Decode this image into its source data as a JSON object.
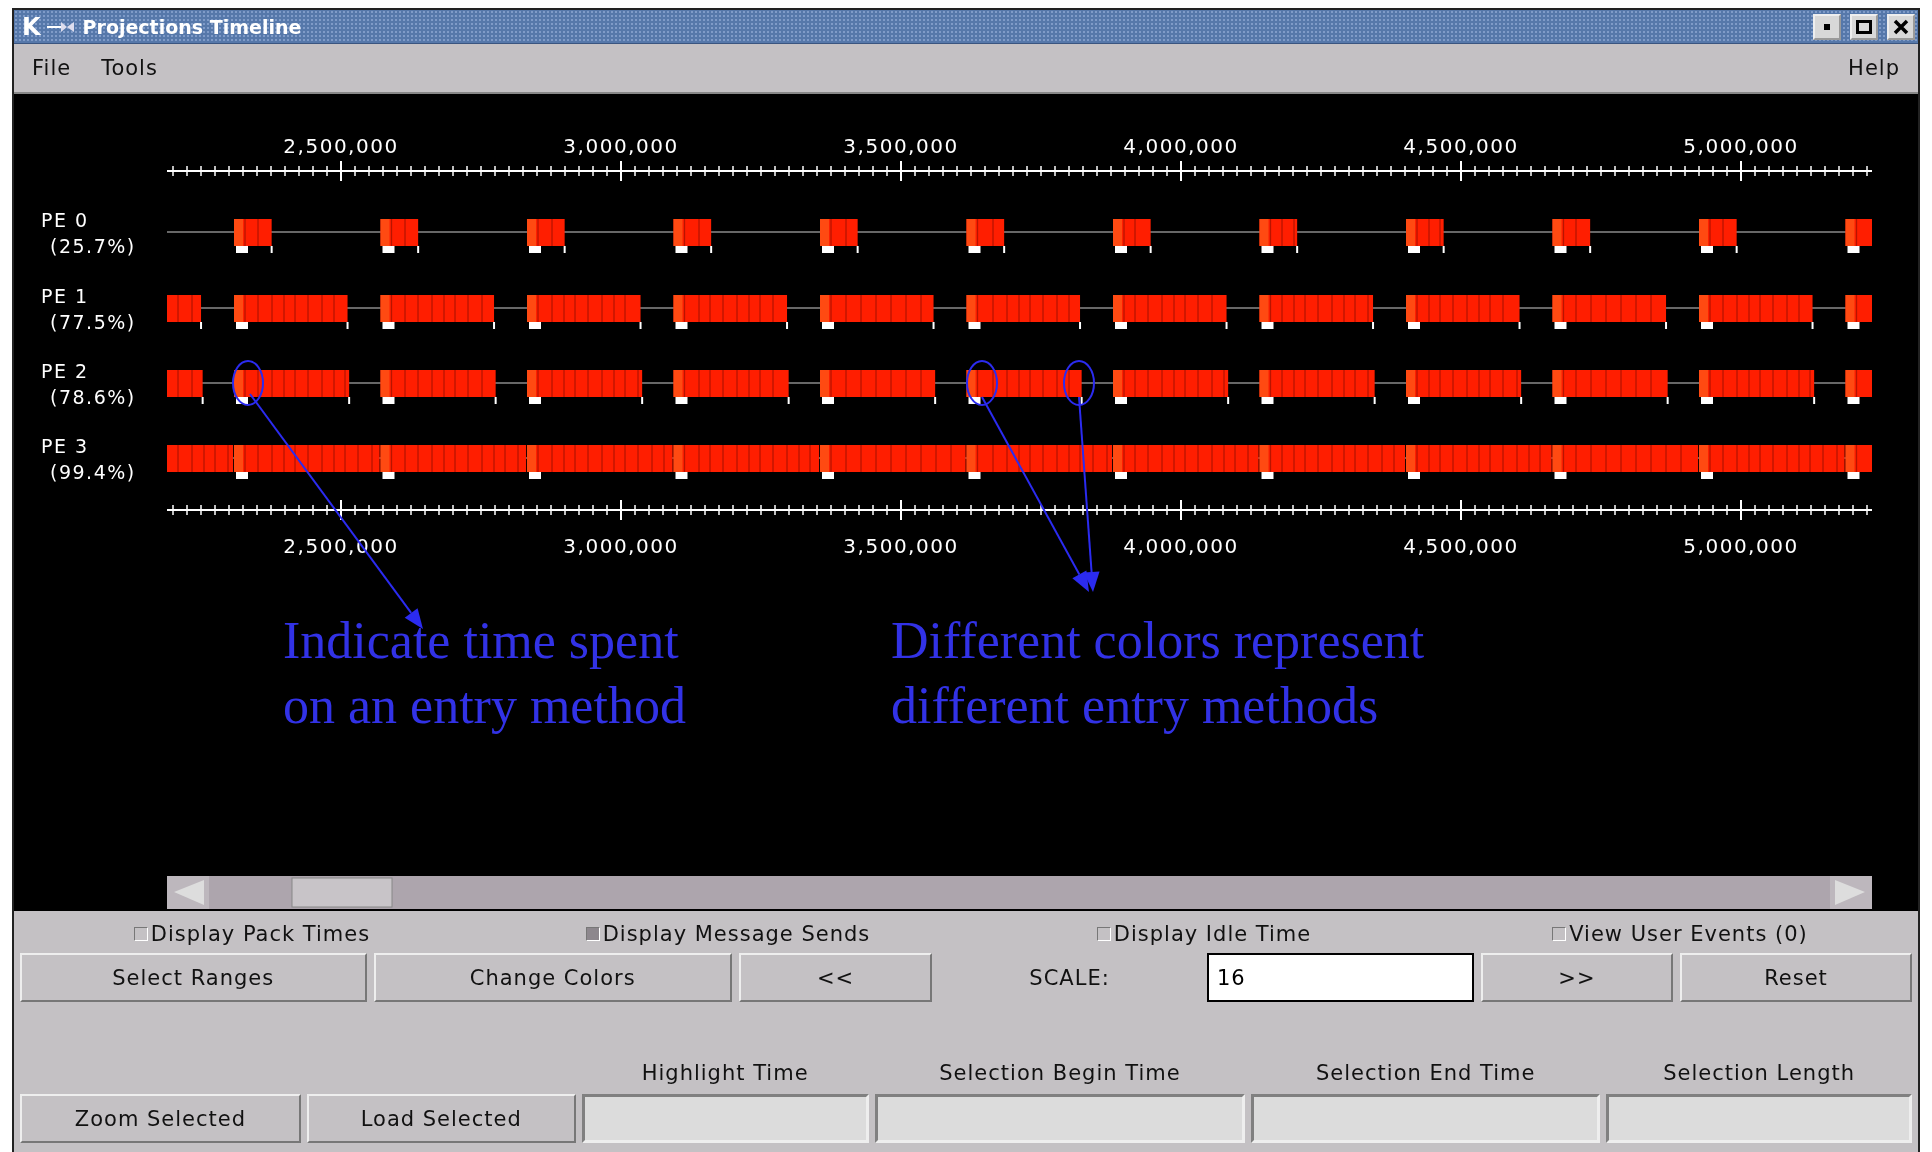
{
  "window": {
    "logo": "K",
    "title": "Projections Timeline"
  },
  "menu": [
    {
      "label": "File"
    },
    {
      "label": "Tools"
    },
    {
      "label": "Help"
    }
  ],
  "top_axis_labels": [
    "2,500,000",
    "3,000,000",
    "3,500,000",
    "4,000,000",
    "4,500,000",
    "5,000,000"
  ],
  "bottom_axis_labels": [
    "2,500,000",
    "3,000,000",
    "3,500,000",
    "4,000,000",
    "4,500,000",
    "5,000,000"
  ],
  "processors": [
    {
      "name": "PE 0",
      "utilization": "(25.7%)"
    },
    {
      "name": "PE 1",
      "utilization": "(77.5%)"
    },
    {
      "name": "PE 2",
      "utilization": "(78.6%)"
    },
    {
      "name": "PE 3",
      "utilization": "(99.4%)"
    }
  ],
  "annotations": [
    {
      "text": "Indicate time spent\non an entry method"
    },
    {
      "text": "Different colors represent\ndifferent entry methods"
    }
  ],
  "checkboxes": [
    {
      "label": "Display Pack Times",
      "checked": false,
      "disabled": false
    },
    {
      "label": "Display Message Sends",
      "checked": false,
      "disabled": true
    },
    {
      "label": "Display Idle Time",
      "checked": false,
      "disabled": false
    },
    {
      "label": "View User Events (0)",
      "checked": false,
      "disabled": false
    }
  ],
  "controls": [
    {
      "kind": "button",
      "label": "Select Ranges"
    },
    {
      "kind": "button",
      "label": "Change Colors"
    },
    {
      "kind": "button",
      "label": "<<"
    },
    {
      "kind": "label",
      "label": "SCALE:"
    },
    {
      "kind": "field",
      "value": "16"
    },
    {
      "kind": "button",
      "label": ">>"
    },
    {
      "kind": "button",
      "label": "Reset"
    }
  ],
  "selection_buttons": [
    "Zoom Selected",
    "Load Selected"
  ],
  "selection_fields": [
    {
      "label": "Highlight Time"
    },
    {
      "label": "Selection Begin Time"
    },
    {
      "label": "Selection End Time"
    },
    {
      "label": "Selection Length"
    }
  ]
}
